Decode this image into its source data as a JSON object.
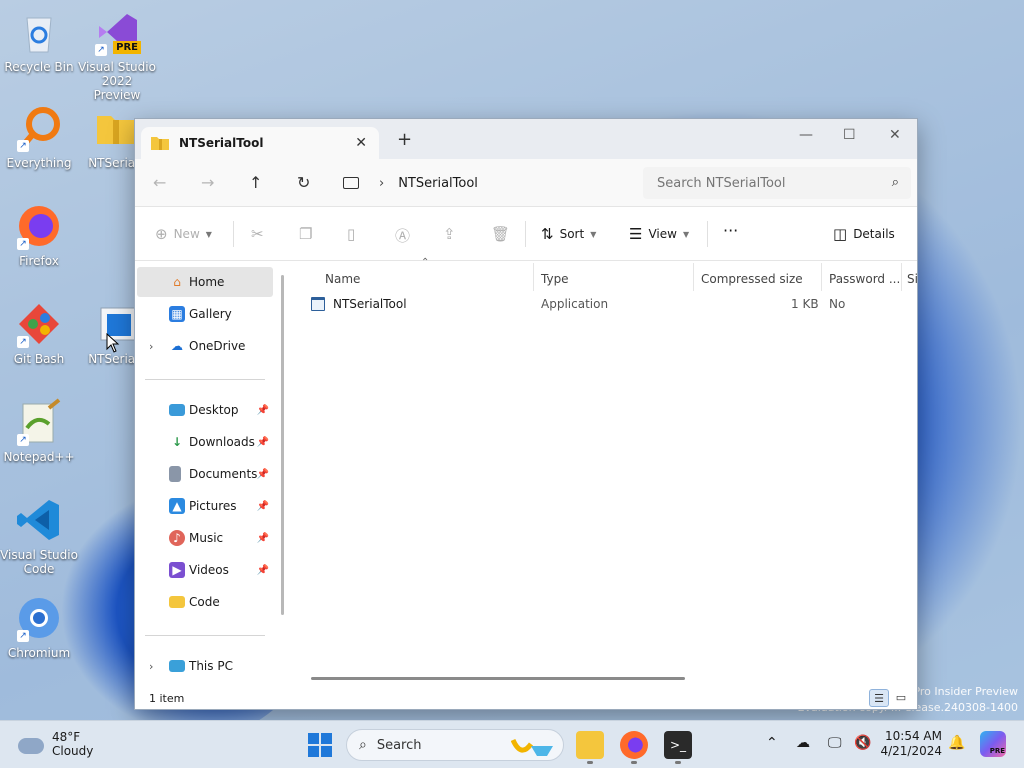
{
  "desktop": {
    "icons": [
      {
        "label": "Recycle Bin"
      },
      {
        "label": "Visual Studio 2022 Preview",
        "badge": "PRE"
      },
      {
        "label": "Everything"
      },
      {
        "label": "NTSerialT"
      },
      {
        "label": "Firefox"
      },
      {
        "label": "Git Bash"
      },
      {
        "label": "NTSerialT"
      },
      {
        "label": "Notepad++"
      },
      {
        "label": "Visual Studio Code"
      },
      {
        "label": "Chromium"
      }
    ],
    "watermark_line1": "Pro Insider Preview",
    "watermark_line2": "Evaluation copy. ... elease.240308-1400"
  },
  "window": {
    "tab_title": "NTSerialTool",
    "tab_close": "✕",
    "tab_add": "+",
    "address": "NTSerialTool",
    "search_placeholder": "Search NTSerialTool",
    "toolbar": {
      "new_label": "New",
      "sort_label": "Sort",
      "view_label": "View",
      "more_label": "···",
      "details_label": "Details"
    },
    "sidebar": {
      "items": [
        {
          "label": "Home"
        },
        {
          "label": "Gallery"
        },
        {
          "label": "OneDrive"
        },
        {
          "label": "Desktop"
        },
        {
          "label": "Downloads"
        },
        {
          "label": "Documents"
        },
        {
          "label": "Pictures"
        },
        {
          "label": "Music"
        },
        {
          "label": "Videos"
        },
        {
          "label": "Code"
        },
        {
          "label": "This PC"
        }
      ]
    },
    "columns": {
      "name": "Name",
      "type": "Type",
      "compressed_size": "Compressed size",
      "password": "Password ...",
      "size": "Si"
    },
    "rows": [
      {
        "name": "NTSerialTool",
        "type": "Application",
        "compressed_size": "1 KB",
        "password": "No"
      }
    ],
    "status": "1 item"
  },
  "taskbar": {
    "temperature": "48°F",
    "condition": "Cloudy",
    "search_label": "Search",
    "time": "10:54 AM",
    "date": "4/21/2024"
  },
  "colors": {
    "accent": "#1f78d9",
    "window_bg": "#ffffff",
    "titlebar_bg": "#e9ecf1",
    "taskbar_bg": "#dde6f0"
  }
}
